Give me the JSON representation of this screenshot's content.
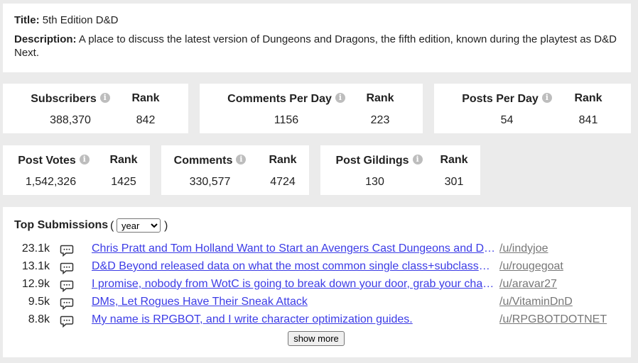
{
  "info": {
    "title_label": "Title:",
    "title_value": "5th Edition D&D",
    "description_label": "Description:",
    "description_value": "A place to discuss the latest version of Dungeons and Dragons, the fifth edition, known during the playtest as D&D Next."
  },
  "stats": {
    "info_glyph": "i",
    "rank_label": "Rank",
    "subscribers": {
      "label": "Subscribers",
      "value": "388,370",
      "rank": "842"
    },
    "comments_per_day": {
      "label": "Comments Per Day",
      "value": "1156",
      "rank": "223"
    },
    "posts_per_day": {
      "label": "Posts Per Day",
      "value": "54",
      "rank": "841"
    },
    "post_votes": {
      "label": "Post Votes",
      "value": "1,542,326",
      "rank": "1425"
    },
    "comments": {
      "label": "Comments",
      "value": "330,577",
      "rank": "4724"
    },
    "post_gildings": {
      "label": "Post Gildings",
      "value": "130",
      "rank": "301"
    }
  },
  "top": {
    "title": "Top Submissions",
    "open_paren": "(",
    "close_paren": ")",
    "period_selected": "year",
    "show_more": "show more",
    "submissions": [
      {
        "score": "23.1k",
        "title": "Chris Pratt and Tom Holland Want to Start an Avengers Cast Dungeons and Dragons Game",
        "user": "/u/indyjoe"
      },
      {
        "score": "13.1k",
        "title": "D&D Beyond released data on what the most common single class+subclasses are",
        "user": "/u/rougegoat"
      },
      {
        "score": "12.9k",
        "title": "I promise, nobody from WotC is going to break down your door, grab your character sheets and rip them up",
        "user": "/u/aravar27"
      },
      {
        "score": "9.5k",
        "title": "DMs, Let Rogues Have Their Sneak Attack",
        "user": "/u/VitaminDnD"
      },
      {
        "score": "8.8k",
        "title": "My name is RPGBOT, and I write character optimization guides.",
        "user": "/u/RPGBOTDOTNET"
      }
    ]
  }
}
